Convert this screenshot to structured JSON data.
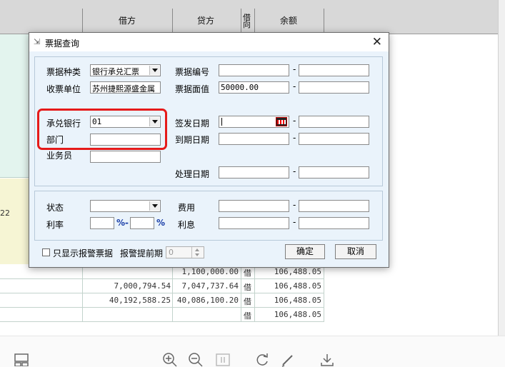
{
  "window": {
    "minimize": "—",
    "maximize": "☐",
    "close": "✕"
  },
  "table": {
    "headers": {
      "debit": "借方",
      "credit": "贷方",
      "direction": "借\n向",
      "balance": "余额"
    },
    "left_partial_text": "22",
    "rows": [
      {
        "debit": "",
        "credit": "1,100,000.00",
        "dir": "借",
        "balance": "106,488.05"
      },
      {
        "debit": "7,000,794.54",
        "credit": "7,047,737.64",
        "dir": "借",
        "balance": "106,488.05"
      },
      {
        "debit": "40,192,588.25",
        "credit": "40,086,100.20",
        "dir": "借",
        "balance": "106,488.05"
      },
      {
        "debit": "",
        "credit": "",
        "dir": "借",
        "balance": "106,488.05"
      }
    ]
  },
  "dialog": {
    "title": "票据查询",
    "close_label": "✕",
    "labels": {
      "bill_type": "票据种类",
      "receiving_unit": "收票单位",
      "accepting_bank": "承兑银行",
      "department": "部门",
      "salesperson": "业务员",
      "bill_number": "票据编号",
      "face_value": "票据面值",
      "issue_date": "签发日期",
      "due_date": "到期日期",
      "process_date": "处理日期",
      "status": "状态",
      "rate": "利率",
      "fee": "费用",
      "interest": "利息"
    },
    "values": {
      "bill_type": "银行承兑汇票",
      "receiving_unit": "苏州捷熙源盛金属",
      "accepting_bank": "01",
      "face_value_from": "50000.00"
    },
    "dash": "-",
    "percent": "%",
    "percent_dash": "%-",
    "bottom": {
      "alarm_only": "只显示报警票据",
      "alarm_advance": "报警提前期",
      "alarm_value": "0",
      "ok": "确定",
      "cancel": "取消"
    }
  }
}
